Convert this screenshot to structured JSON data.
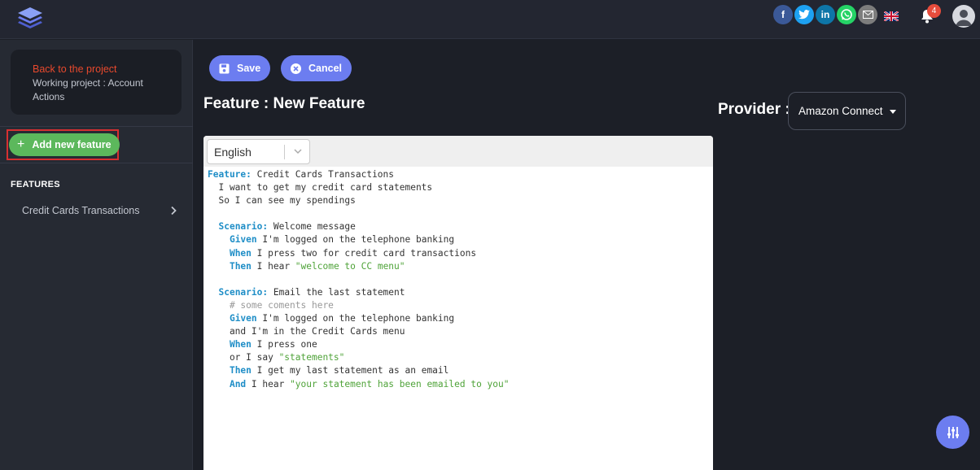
{
  "topbar": {
    "social_icons": [
      {
        "name": "facebook",
        "glyph": "f",
        "color": "#3b5998"
      },
      {
        "name": "twitter",
        "glyph": "t",
        "color": "#1da1f2"
      },
      {
        "name": "linkedin",
        "glyph": "in",
        "color": "#0e76a8"
      },
      {
        "name": "whatsapp",
        "glyph": "w",
        "color": "#25d366"
      },
      {
        "name": "email",
        "glyph": "@",
        "color": "#7d7d7d"
      }
    ],
    "language_flag": "uk-flag",
    "notification_count": "4"
  },
  "sidebar": {
    "back_link": "Back to the project",
    "working_project": "Working project : Account Actions",
    "add_feature_label": "Add new feature",
    "features_heading": "FEATURES",
    "features": [
      "Credit Cards Transactions"
    ]
  },
  "toolbar": {
    "save_label": "Save",
    "cancel_label": "Cancel"
  },
  "main": {
    "page_title": "Feature : New Feature",
    "provider_label": "Provider :",
    "provider_value": "Amazon Connect"
  },
  "editor": {
    "language": "English",
    "lines": [
      [
        {
          "t": "Feature:",
          "c": "kw"
        },
        {
          "t": " Credit Cards Transactions",
          "c": ""
        }
      ],
      [
        {
          "t": "  I want to get my credit card statements",
          "c": ""
        }
      ],
      [
        {
          "t": "  So I can see my spendings",
          "c": ""
        }
      ],
      [
        {
          "t": "",
          "c": ""
        }
      ],
      [
        {
          "t": "  ",
          "c": ""
        },
        {
          "t": "Scenario:",
          "c": "kw"
        },
        {
          "t": " Welcome message",
          "c": ""
        }
      ],
      [
        {
          "t": "    ",
          "c": ""
        },
        {
          "t": "Given",
          "c": "kw"
        },
        {
          "t": " I'm logged on the telephone banking",
          "c": ""
        }
      ],
      [
        {
          "t": "    ",
          "c": ""
        },
        {
          "t": "When",
          "c": "kw"
        },
        {
          "t": " I press two for credit card transactions",
          "c": ""
        }
      ],
      [
        {
          "t": "    ",
          "c": ""
        },
        {
          "t": "Then",
          "c": "kw"
        },
        {
          "t": " I hear ",
          "c": ""
        },
        {
          "t": "\"welcome to CC menu\"",
          "c": "str"
        }
      ],
      [
        {
          "t": "",
          "c": ""
        }
      ],
      [
        {
          "t": "  ",
          "c": ""
        },
        {
          "t": "Scenario:",
          "c": "kw"
        },
        {
          "t": " Email the last statement",
          "c": ""
        }
      ],
      [
        {
          "t": "    # some coments here",
          "c": "cm"
        }
      ],
      [
        {
          "t": "    ",
          "c": ""
        },
        {
          "t": "Given",
          "c": "kw"
        },
        {
          "t": " I'm logged on the telephone banking",
          "c": ""
        }
      ],
      [
        {
          "t": "    and I'm in the Credit Cards menu",
          "c": ""
        }
      ],
      [
        {
          "t": "    ",
          "c": ""
        },
        {
          "t": "When",
          "c": "kw"
        },
        {
          "t": " I press one",
          "c": ""
        }
      ],
      [
        {
          "t": "    or I say ",
          "c": ""
        },
        {
          "t": "\"statements\"",
          "c": "str"
        }
      ],
      [
        {
          "t": "    ",
          "c": ""
        },
        {
          "t": "Then",
          "c": "kw"
        },
        {
          "t": " I get my last statement as an email",
          "c": ""
        }
      ],
      [
        {
          "t": "    ",
          "c": ""
        },
        {
          "t": "And",
          "c": "kw"
        },
        {
          "t": " I hear ",
          "c": ""
        },
        {
          "t": "\"your statement has been emailed to you\"",
          "c": "str"
        }
      ]
    ]
  },
  "colors": {
    "accent": "#6c7df0",
    "add_button": "#5cb85c",
    "back_link": "#e8492d",
    "keyword": "#1f8ec7",
    "string": "#4fa339"
  }
}
